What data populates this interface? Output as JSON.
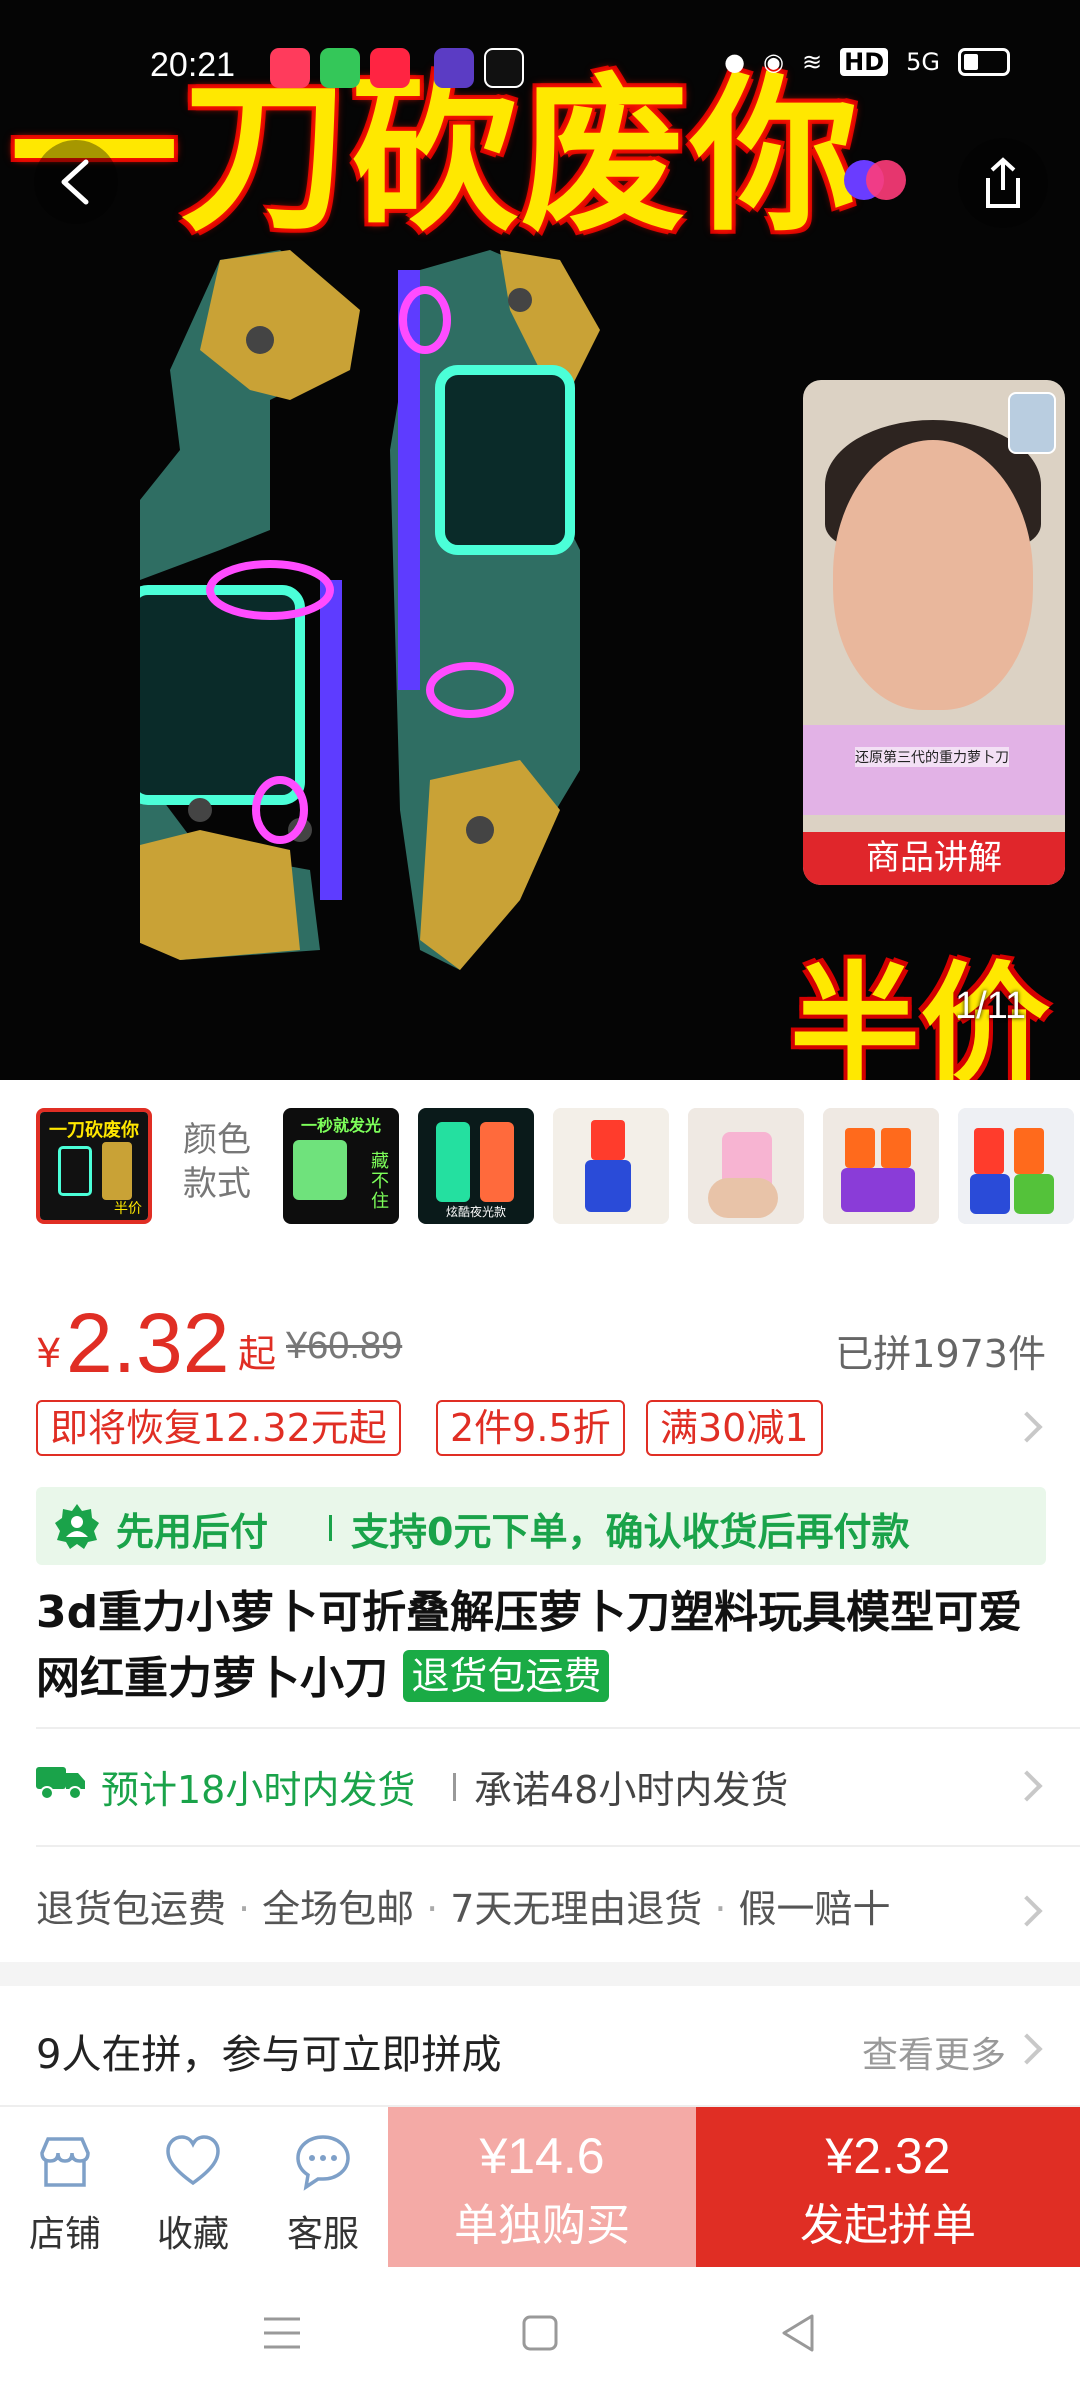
{
  "status_bar": {
    "time": "20:21",
    "network_label": "HD",
    "signal_label": "5G"
  },
  "hero": {
    "banner_title": "一刀砍废你",
    "banner_sub": "半价",
    "image_counter": "1/11",
    "video_card": {
      "caption": "还原第三代的重力萝卜刀",
      "cta": "商品讲解"
    }
  },
  "thumbnails": {
    "color_label_line1": "颜色",
    "color_label_line2": "款式",
    "items": [
      {
        "text": "一刀砍废你",
        "sub": "半价",
        "active": true
      },
      {
        "text": "一秒就发光",
        "sub": "藏不住"
      },
      {
        "text": "",
        "sub": "炫酷夜光款"
      },
      {
        "text": ""
      },
      {
        "text": ""
      },
      {
        "text": ""
      },
      {
        "text": ""
      }
    ]
  },
  "price": {
    "currency": "¥",
    "current": "2.32",
    "suffix": "起",
    "original": "¥60.89",
    "sold": "已拼1973件"
  },
  "promo_tags": [
    "即将恢复12.32元起",
    "2件9.5折",
    "满30减1"
  ],
  "pay_after": {
    "label": "先用后付",
    "desc": "支持0元下单，确认收货后再付款"
  },
  "product": {
    "title": "3d重力小萝卜可折叠解压萝卜刀塑料玩具模型可爱网红重力萝卜小刀",
    "badge": "退货包运费"
  },
  "shipping": {
    "estimate": "预计18小时内发货",
    "promise": "承诺48小时内发货"
  },
  "services": [
    "退货包运费",
    "全场包邮",
    "7天无理由退货",
    "假一赔十"
  ],
  "group_buy": {
    "text": "9人在拼，参与可立即拼成",
    "more": "查看更多"
  },
  "bottom_bar": {
    "store": "店铺",
    "favorite": "收藏",
    "service": "客服",
    "single_price": "¥14.6",
    "single_label": "单独购买",
    "group_price": "¥2.32",
    "group_label": "发起拼单"
  },
  "colors": {
    "brand_red": "#e02e24",
    "green": "#1aa34a",
    "light_red": "#f4aaa6"
  }
}
